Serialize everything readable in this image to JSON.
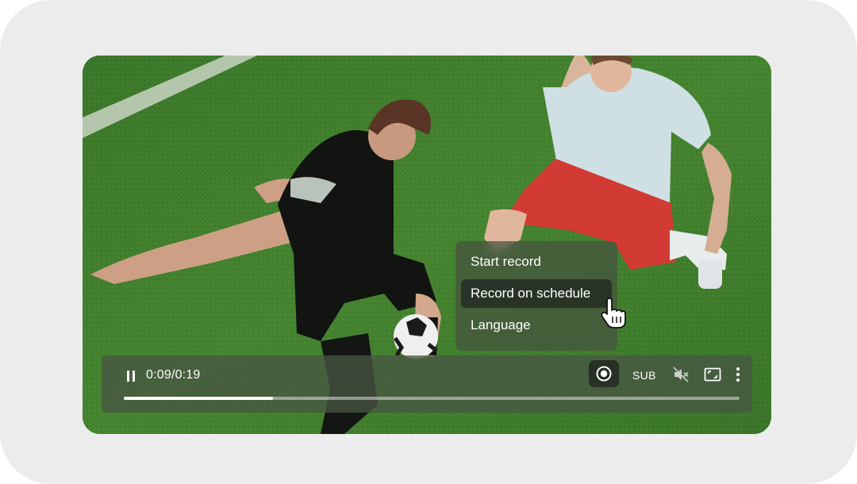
{
  "player": {
    "time_display": "0:09/0:19",
    "progress": 0.242,
    "subtitle_label": "SUB"
  },
  "menu": {
    "items": [
      {
        "label": "Start record",
        "active": false
      },
      {
        "label": "Record on schedule",
        "active": true
      },
      {
        "label": "Language",
        "active": false
      }
    ]
  },
  "icons": {
    "play_pause": "pause-icon",
    "record": "record-icon",
    "mute": "volume-muted-icon",
    "fullscreen": "fullscreen-icon",
    "more": "more-vertical-icon",
    "cursor": "hand-pointer-cursor"
  },
  "colors": {
    "frame_background": "#ececed",
    "control_bar": "#485642",
    "progress_fill": "#ffffff",
    "pitch_green": "#3f7a2a"
  }
}
